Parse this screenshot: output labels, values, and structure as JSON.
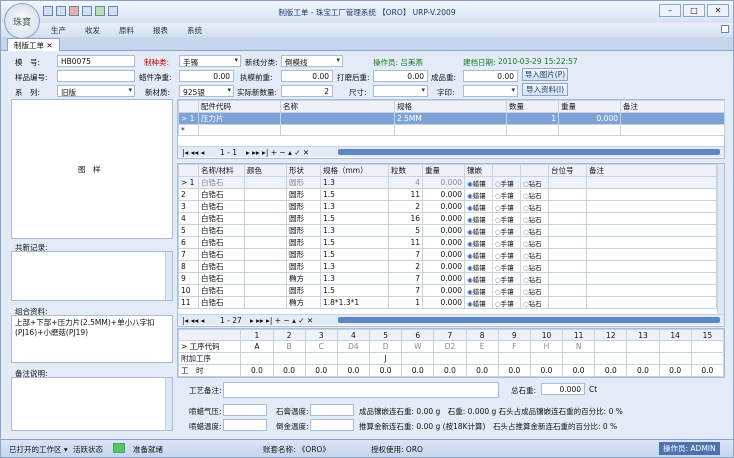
{
  "window": {
    "title": "制版工单 - 珠宝工厂管理系统 【ORO】 URP-V.2009",
    "logo_text": "珠寶"
  },
  "menu": {
    "items": [
      "生产",
      "收发",
      "原料",
      "报表",
      "系统"
    ]
  },
  "tab": {
    "label": "制版工单"
  },
  "form": {
    "mh_label": "模　号:",
    "mh": "HB0075",
    "zzl_label": "制种类:",
    "zzl": "手镯",
    "xxfl_label": "新线分类:",
    "xxfl": "倒模线",
    "czy_label": "操作员: 吕美燕",
    "jdrq_label": "建档日期:",
    "jdrq": "2010-03-29 15:22:57",
    "ypbh_label": "样品编号:",
    "ljjz_label": "蜡件净重:",
    "ljjz": "0.00",
    "zmqz_label": "执模前重:",
    "zmqz": "0.00",
    "dmhz_label": "打磨后重:",
    "dmhz": "0.00",
    "cpz_label": "成品重:",
    "cpz": "0.00",
    "xl_label": "系　列:",
    "xl": "旧版",
    "xcz_label": "新材质:",
    "xcz": "925银",
    "sjxs_label": "实际新数量:",
    "sjxs": "2",
    "cc_label": "尺寸:",
    "zy_label": "字印:",
    "btn_img": "导入图片(P)",
    "btn_data": "导入资料(I)"
  },
  "left": {
    "image_label": "图　样",
    "shared_label": "共新记录:",
    "combo_label": "组合资料:",
    "combo_text": "上部+下部+压力片(2.5MM)+单小八字扣(PJ16)+小磨菇(PJ19)",
    "notes_label": "备注说明:"
  },
  "parts": {
    "headers": [
      "",
      "配件代码",
      "名称",
      "规格",
      "数量",
      "重量",
      "备注"
    ],
    "rows": [
      [
        "> 1",
        "压力片",
        "",
        "2.5MM",
        "1",
        "0.000",
        ""
      ]
    ],
    "pager": "1 - 1"
  },
  "stones": {
    "headers": [
      "",
      "名称/材料",
      "颜色",
      "形状",
      "规格（mm）",
      "粒数",
      "重量",
      "镶嵌",
      "",
      "",
      "台位号",
      "备注"
    ],
    "rows": [
      [
        "> 1",
        "白锆石",
        "",
        "圆形",
        "1.3",
        "4",
        "0.000"
      ],
      [
        "2",
        "白锆石",
        "",
        "圆形",
        "1.5",
        "11",
        "0.000"
      ],
      [
        "3",
        "白锆石",
        "",
        "圆形",
        "1.3",
        "2",
        "0.000"
      ],
      [
        "4",
        "白锆石",
        "",
        "圆形",
        "1.5",
        "16",
        "0.000"
      ],
      [
        "5",
        "白锆石",
        "",
        "圆形",
        "1.3",
        "5",
        "0.000"
      ],
      [
        "6",
        "白锆石",
        "",
        "圆形",
        "1.5",
        "11",
        "0.000"
      ],
      [
        "7",
        "白锆石",
        "",
        "圆形",
        "1.5",
        "7",
        "0.000"
      ],
      [
        "8",
        "白锆石",
        "",
        "圆形",
        "1.3",
        "2",
        "0.000"
      ],
      [
        "9",
        "白锆石",
        "",
        "椭方",
        "1.3",
        "7",
        "0.000"
      ],
      [
        "10",
        "白锆石",
        "",
        "圆形",
        "1.5",
        "7",
        "0.000"
      ],
      [
        "11",
        "白锆石",
        "",
        "椭方",
        "1.8*1.3*1",
        "1",
        "0.000"
      ]
    ],
    "inlay": [
      "蜡镶",
      "手镶",
      "钻石"
    ],
    "pager": "1 - 27"
  },
  "process": {
    "cols": [
      "1",
      "2",
      "3",
      "4",
      "5",
      "6",
      "7",
      "8",
      "9",
      "10",
      "11",
      "12",
      "13",
      "14",
      "15"
    ],
    "row1_label": "> 工序代码",
    "codes": [
      "A",
      "B",
      "C",
      "D4",
      "D",
      "W",
      "D2",
      "E",
      "F",
      "H",
      "N",
      "",
      "",
      "",
      ""
    ],
    "row2_label": "附加工序",
    "extra": [
      "",
      "",
      "",
      "",
      "J",
      "",
      "",
      "",
      "",
      "",
      "",
      "",
      "",
      "",
      ""
    ],
    "row3_label": "工　时",
    "hours": [
      "0.0",
      "0.0",
      "0.0",
      "0.0",
      "0.0",
      "0.0",
      "0.0",
      "0.0",
      "0.0",
      "0.0",
      "0.0",
      "0.0",
      "0.0",
      "0.0",
      "0.0"
    ]
  },
  "bottom": {
    "gybz_label": "工艺备注:",
    "zsz_label": "总石重:",
    "zsz": "0.000",
    "zsz_unit": "Ct",
    "pql_label": "喷蜡气压:",
    "sgwd_label": "石膏温度:",
    "jlsz": "成品镶嵌连石重: 0.00 g　石重: 0.000 g 石头占成品镶嵌连石重的百分比: 0 %",
    "plwd_label": "喷蜡温度:",
    "dwjwd_label": "倒金温度:",
    "tsjs": "推算金新连石重: 0.00 g (按18K计算)　石头占推算金新连石重的百分比: 0 %"
  },
  "status": {
    "open": "已打开的工作区 ▾",
    "active": "活跃状态",
    "ready": "准备就绪",
    "account": "账套名称: 《ORO》",
    "license": "授权使用: ORO",
    "operator": "操作员: ADMIN"
  }
}
